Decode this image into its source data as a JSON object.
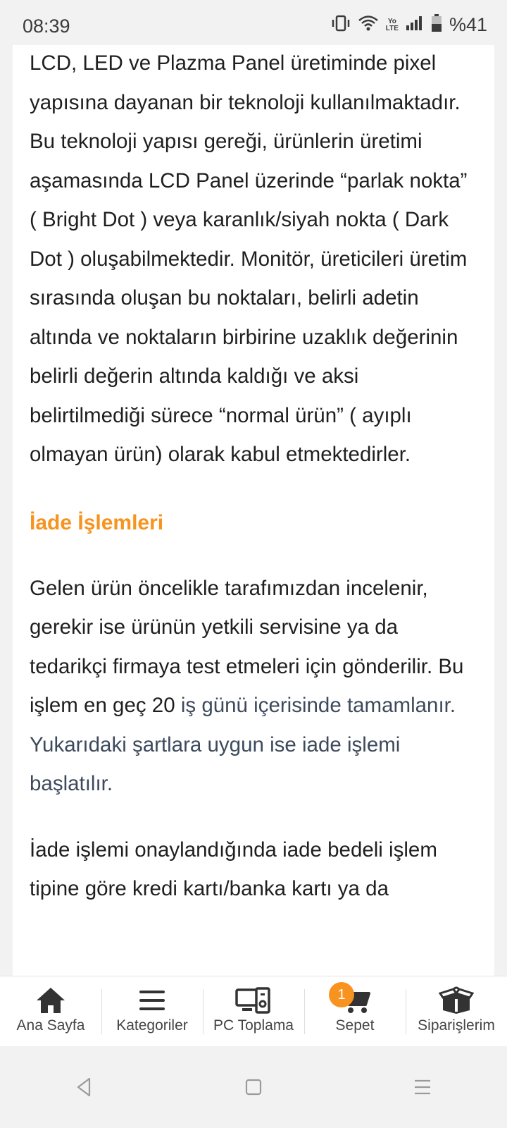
{
  "status_bar": {
    "time": "08:39",
    "battery_text": "%41",
    "network_top": "Yo",
    "network_bottom": "LTE"
  },
  "article": {
    "paragraph1": "LCD, LED ve Plazma Panel üretiminde pixel yapısına dayanan bir teknoloji kullanılmaktadır. Bu teknoloji yapısı gereği, ürünlerin üretimi aşamasında LCD Panel üzerinde “parlak nokta” ( Bright Dot ) veya karanlık/siyah nokta ( Dark Dot ) oluşabilmektedir. Monitör, üreticileri üretim sırasında oluşan bu noktaları, belirli adetin altında ve noktaların birbirine uzaklık değerinin belirli değerin altında kaldığı ve aksi belirtilmediği sürece “normal ürün” ( ayıplı olmayan ürün) olarak kabul etmektedirler.",
    "section_title": "İade İşlemleri",
    "paragraph2_part1": "Gelen ürün öncelikle tarafımızdan incelenir, gerekir ise ürünün yetkili servisine ya da tedarikçi firmaya test etmeleri için gönderilir. Bu işlem en geç 20 ",
    "paragraph2_part2": "iş günü içerisinde tamamlanır. Yukarıdaki şartlara uygun ise iade işlemi başlatılır.",
    "paragraph3": "İade işlemi onaylandığında iade bedeli işlem tipine göre kredi kartı/banka kartı ya da"
  },
  "bottom_nav": {
    "items": [
      {
        "label": "Ana Sayfa",
        "icon": "home-icon"
      },
      {
        "label": "Kategoriler",
        "icon": "menu-icon"
      },
      {
        "label": "PC Toplama",
        "icon": "pc-build-icon"
      },
      {
        "label": "Sepet",
        "icon": "cart-icon",
        "badge": "1"
      },
      {
        "label": "Siparişlerim",
        "icon": "orders-box-icon"
      }
    ]
  },
  "colors": {
    "accent": "#f7931e",
    "link_text": "#3d4a5c",
    "body_text": "#1f1f1f"
  }
}
